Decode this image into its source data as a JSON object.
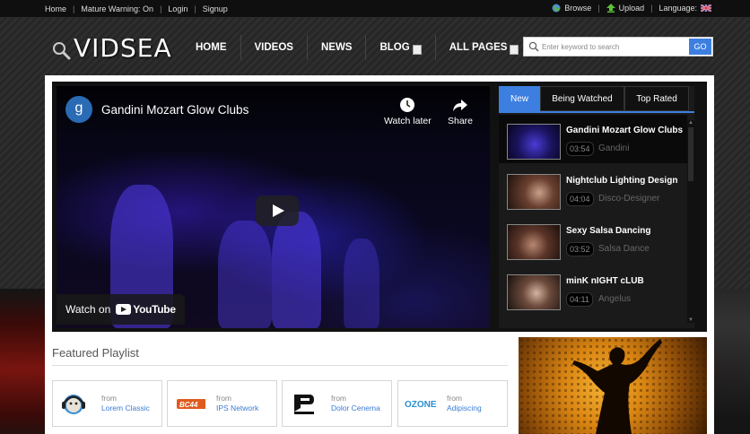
{
  "topbar": {
    "links": [
      "Home",
      "Mature Warning: On",
      "Login",
      "Signup"
    ],
    "browse": "Browse",
    "upload": "Upload",
    "language": "Language:"
  },
  "logo": "VIDSEA",
  "nav": [
    "HOME",
    "VIDEOS",
    "NEWS",
    "BLOG",
    "ALL PAGES"
  ],
  "search": {
    "placeholder": "Enter keyword to search",
    "button": "GO"
  },
  "video": {
    "channel_initial": "g",
    "title": "Gandini Mozart Glow Clubs",
    "watch_later": "Watch later",
    "share": "Share",
    "watch_on": "Watch on",
    "youtube": "YouTube"
  },
  "playlist": {
    "tabs": [
      "New",
      "Being Watched",
      "Top Rated"
    ],
    "active_tab": "New",
    "items": [
      {
        "title": "Gandini Mozart Glow Clubs",
        "duration": "03:54",
        "author": "Gandini"
      },
      {
        "title": "Nightclub Lighting Design",
        "duration": "04:04",
        "author": "Disco-Designer"
      },
      {
        "title": "Sexy Salsa Dancing",
        "duration": "03:52",
        "author": "Salsa Dance"
      },
      {
        "title": "minK nIGHT cLUB",
        "duration": "04:11",
        "author": "Angelus"
      }
    ]
  },
  "featured": {
    "title": "Featured Playlist",
    "cards": [
      {
        "from": "from",
        "name": "Lorem Classic",
        "icon": "monkey-headphones-icon"
      },
      {
        "from": "from",
        "name": "IPS Network",
        "icon": "ips-logo-icon"
      },
      {
        "from": "from",
        "name": "Dolor Cenema",
        "icon": "dolor-logo-icon"
      },
      {
        "from": "from",
        "name": "Adipiscing",
        "icon": "ozone-logo-icon"
      }
    ]
  },
  "colors": {
    "accent": "#3d7fe0",
    "link": "#3a7bd5"
  }
}
